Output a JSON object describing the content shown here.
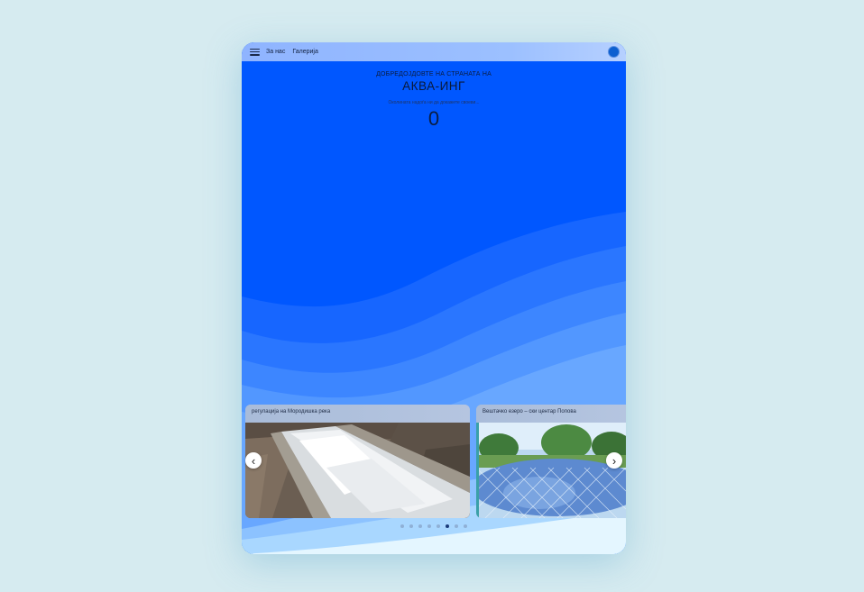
{
  "nav": {
    "menu_icon": "hamburger-menu-icon",
    "links": [
      "За нас",
      "Галерија"
    ],
    "profile_icon": "avatar-icon"
  },
  "hero": {
    "welcome": "ДОБРЕДОЈДОВТЕ НА СТРАНАТА НА",
    "brand": "АКВА-ИНГ",
    "tagline": "Околината надоѓа ни да докажете своеви...",
    "counter": "0"
  },
  "gallery": {
    "slides": [
      {
        "caption": "регулација на Мородишка река"
      },
      {
        "caption": "Вештачко езеро – ски центар Попова"
      }
    ],
    "prev_icon": "chevron-left-icon",
    "next_icon": "chevron-right-icon",
    "dot_count": 8,
    "active_dot": 5
  },
  "colors": {
    "page_bg": "#d6ebf0",
    "primary_blue": "#0057ff",
    "topbar": "#9cc0ff",
    "wave_light": "#e4f6ff"
  }
}
